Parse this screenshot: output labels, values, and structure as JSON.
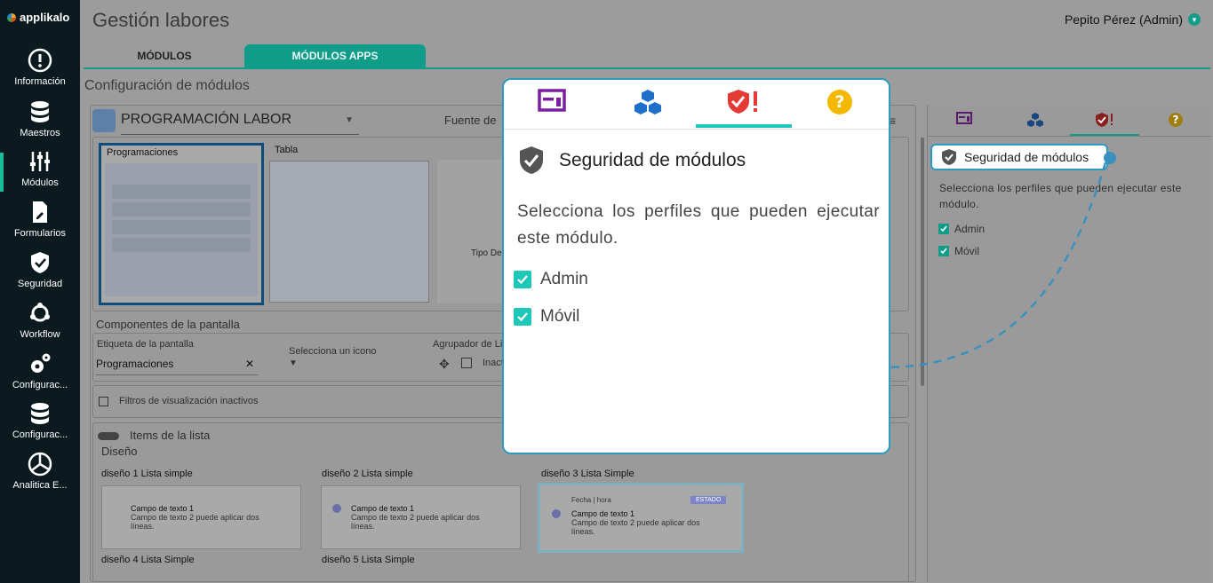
{
  "brand": {
    "name": "applikalo"
  },
  "sidebar": {
    "items": [
      {
        "label": "Información",
        "icon": "info-icon"
      },
      {
        "label": "Maestros",
        "icon": "database-icon"
      },
      {
        "label": "Módulos",
        "icon": "sliders-icon",
        "active": true
      },
      {
        "label": "Formularios",
        "icon": "form-icon"
      },
      {
        "label": "Seguridad",
        "icon": "shield-icon"
      },
      {
        "label": "Workflow",
        "icon": "workflow-icon"
      },
      {
        "label": "Configurac...",
        "icon": "gears-icon"
      },
      {
        "label": "Configurac...",
        "icon": "database-icon"
      },
      {
        "label": "Analitica E...",
        "icon": "pie-icon"
      }
    ]
  },
  "header": {
    "title": "Gestión labores",
    "user": "Pepito Pérez (Admin)"
  },
  "tabs": [
    {
      "label": "MÓDULOS"
    },
    {
      "label": "MÓDULOS APPS",
      "active": true
    }
  ],
  "section": {
    "title": "Configuración de módulos"
  },
  "module": {
    "name": "PROGRAMACIÓN LABOR",
    "source_label": "Fuente de"
  },
  "views": {
    "programaciones": "Programaciones",
    "tabla": "Tabla",
    "tipo": "Tipo De"
  },
  "components": {
    "title": "Componentes de la pantalla",
    "label_field": "Etiqueta de la pantalla",
    "label_value": "Programaciones",
    "icon_select": "Selecciona un icono",
    "group_label": "Agrupador de Li",
    "inactive_label": "Inact",
    "filters": "Filtros de visualización inactivos"
  },
  "list_items": {
    "title": "Items de la lista",
    "design": "Diseño",
    "designs": [
      {
        "label": "diseño 1 Lista simple",
        "line1": "Campo de texto 1",
        "line2": "Campo de texto 2 puede aplicar dos líneas."
      },
      {
        "label": "diseño 2 Lista simple",
        "line1": "Campo de texto 1",
        "line2": "Campo de texto 2 puede aplicar dos líneas."
      },
      {
        "label": "diseño 3 Lista Simple",
        "meta": "Fecha | hora",
        "status": "ESTADO",
        "line1": "Campo de texto 1",
        "line2": "Campo de texto 2 puede aplicar dos líneas."
      },
      {
        "label": "diseño 4 Lista Simple"
      },
      {
        "label": "diseño 5 Lista Simple"
      }
    ]
  },
  "security_panel": {
    "title": "Seguridad de módulos",
    "description": "Selecciona los perfiles que pueden ejecutar este módulo.",
    "profiles": [
      {
        "label": "Admin",
        "checked": true
      },
      {
        "label": "Móvil",
        "checked": true
      }
    ]
  },
  "colors": {
    "teal": "#0f9d8a",
    "accent": "#1ec8b8",
    "purple": "#7b1fa2",
    "blue": "#1e6fc9",
    "red": "#e53935",
    "yellow": "#f5b800"
  }
}
